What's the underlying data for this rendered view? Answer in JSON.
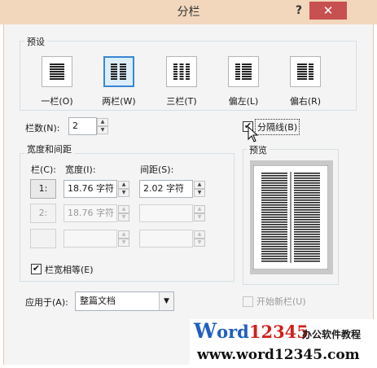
{
  "dialog": {
    "title": "分栏",
    "help": "?",
    "close": "✕"
  },
  "presets": {
    "group_label": "预设",
    "items": [
      {
        "label": "一栏(O)",
        "icon": "one-column-icon"
      },
      {
        "label": "两栏(W)",
        "icon": "two-columns-icon",
        "selected": true
      },
      {
        "label": "三栏(T)",
        "icon": "three-columns-icon"
      },
      {
        "label": "偏左(L)",
        "icon": "left-column-icon"
      },
      {
        "label": "偏右(R)",
        "icon": "right-column-icon"
      }
    ]
  },
  "columns": {
    "label": "栏数(N):",
    "value": "2"
  },
  "separator": {
    "label": "分隔线(B)",
    "checked": true
  },
  "width_spacing": {
    "group_label": "宽度和间距",
    "col_header": "栏(C):",
    "width_header": "宽度(I):",
    "spacing_header": "间距(S):",
    "rows": [
      {
        "num": "1:",
        "width": "18.76 字符",
        "spacing": "2.02 字符",
        "enabled": true
      },
      {
        "num": "2:",
        "width": "18.76 字符",
        "spacing": "",
        "enabled": false
      },
      {
        "num": "",
        "width": "",
        "spacing": "",
        "enabled": false
      }
    ]
  },
  "equal_width": {
    "label": "栏宽相等(E)",
    "checked": true
  },
  "preview": {
    "label": "预览"
  },
  "apply_to": {
    "label": "应用于(A):",
    "value": "整篇文档"
  },
  "new_column": {
    "label": "开始新栏(U)",
    "checked": false
  },
  "watermark": {
    "brand_w": "W",
    "brand_rest": "ord",
    "brand_num": "12345",
    "tagline": "办公软件教程",
    "url": "www.word12345.com"
  },
  "colors": {
    "titlebar": "#f2d7bd",
    "close": "#c75050",
    "selection": "#3a86d4",
    "watermark_blue": "#1f5fbf",
    "watermark_red": "#d0201b"
  }
}
